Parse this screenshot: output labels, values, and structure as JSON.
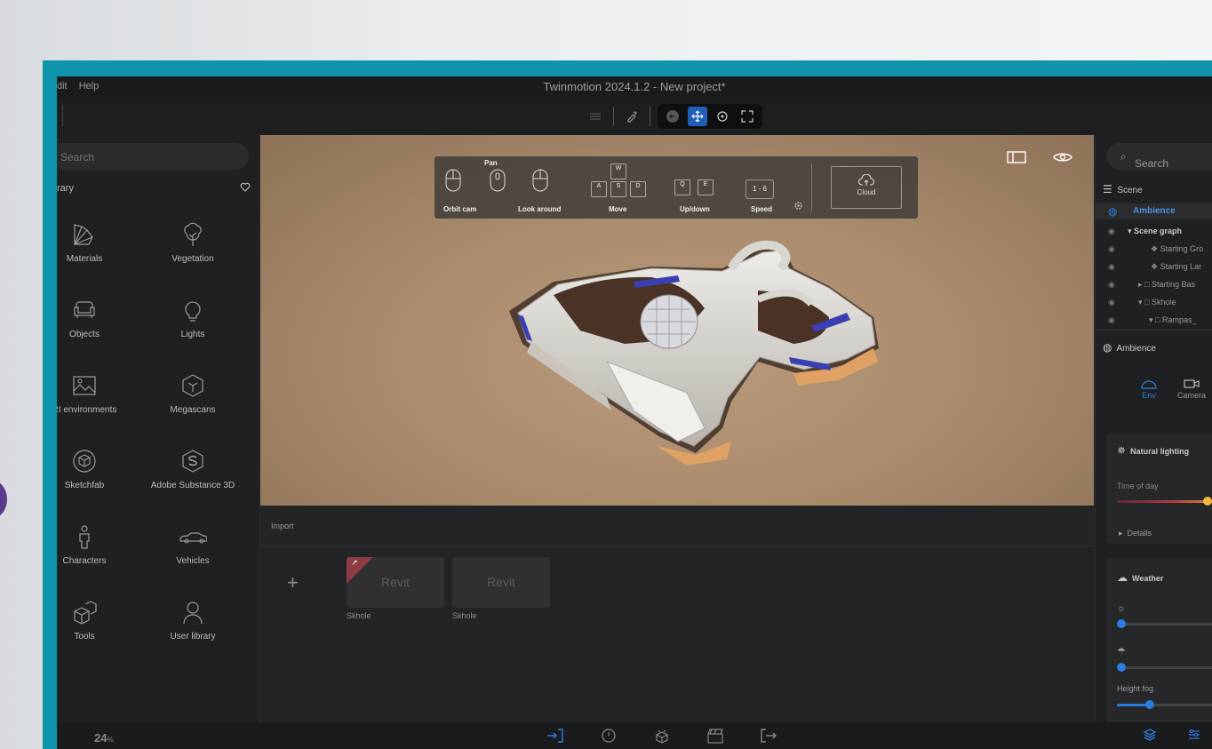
{
  "window": {
    "title": "Twinmotion 2024.1.2 - New project*"
  },
  "menu": {
    "items": [
      "dit",
      "Help"
    ]
  },
  "library": {
    "search_placeholder": "Search",
    "header": "rary",
    "items": [
      {
        "label": "Materials",
        "icon": "materials-icon"
      },
      {
        "label": "Vegetation",
        "icon": "tree-icon"
      },
      {
        "label": "Objects",
        "icon": "sofa-icon"
      },
      {
        "label": "Lights",
        "icon": "bulb-icon"
      },
      {
        "label": "RI environments",
        "icon": "hdri-icon"
      },
      {
        "label": "Megascans",
        "icon": "megascans-icon"
      },
      {
        "label": "Sketchfab",
        "icon": "sketchfab-icon"
      },
      {
        "label": "Adobe Substance 3D",
        "icon": "substance-icon"
      },
      {
        "label": "Characters",
        "icon": "person-icon"
      },
      {
        "label": "Vehicles",
        "icon": "car-icon"
      },
      {
        "label": "Tools",
        "icon": "tools-icon"
      },
      {
        "label": "User library",
        "icon": "user-icon"
      }
    ]
  },
  "nav_help": {
    "pan": "Pan",
    "orbit": "Orbit cam",
    "look": "Look around",
    "move": "Move",
    "updown": "Up/down",
    "speed": "Speed",
    "speed_keys": "1 - 6",
    "cloud": "Cloud",
    "keys": {
      "w": "W",
      "a": "A",
      "s": "S",
      "d": "D",
      "q": "Q",
      "e": "E"
    }
  },
  "import": {
    "label": "Import",
    "add": "+",
    "tiles": [
      {
        "title": "Revit",
        "caption": "Skhole"
      },
      {
        "title": "Revit",
        "caption": "Skhole"
      }
    ]
  },
  "scene_panel": {
    "search_placeholder": "Search",
    "scene_label": "Scene",
    "ambience_active": "Ambience",
    "tree": [
      {
        "label": "Scene graph"
      },
      {
        "label": "Starting Gro"
      },
      {
        "label": "Starting Lar"
      },
      {
        "label": "Starting Bas"
      },
      {
        "label": "Skhole"
      },
      {
        "label": "Rampas_"
      }
    ],
    "ambience_header": "Ambience",
    "tabs": [
      {
        "label": "Env"
      },
      {
        "label": "Camera"
      }
    ],
    "natural_lighting": "Natural lighting",
    "time_of_day": "Time of day",
    "time_of_day_value": 0.8,
    "details": "Details",
    "weather": "Weather",
    "height_fog": "Height fog"
  },
  "status": {
    "zoom": "24",
    "zoom_unit": "%"
  },
  "colors": {
    "accent": "#2a7de1",
    "teal_frame": "#0f94ad"
  }
}
